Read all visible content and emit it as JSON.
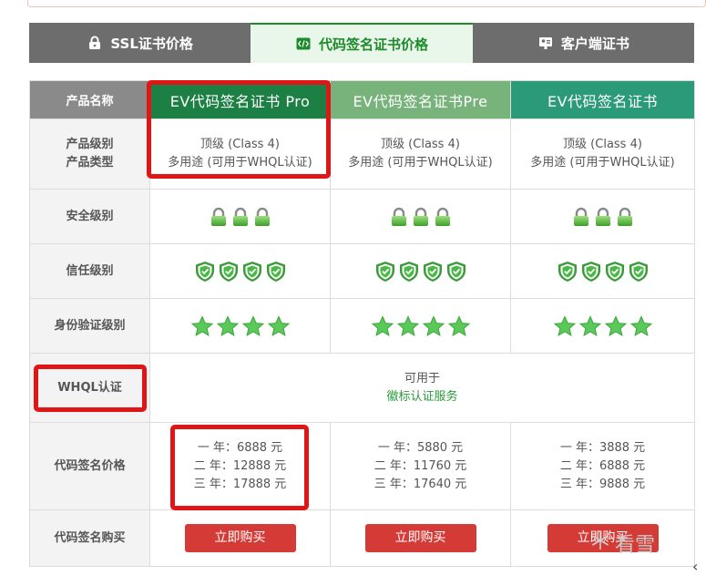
{
  "tabs": [
    {
      "label": "SSL证书价格",
      "icon": "lock-icon"
    },
    {
      "label": "代码签名证书价格",
      "icon": "code-icon"
    },
    {
      "label": "客户端证书",
      "icon": "id-card-icon"
    }
  ],
  "table": {
    "header_label": "产品名称",
    "products": [
      "EV代码签名证书 Pro",
      "EV代码签名证书Pre",
      "EV代码签名证书"
    ],
    "rows": {
      "class_label_1": "产品级别",
      "class_label_2": "产品类型",
      "class_values": [
        {
          "level": "顶级 (Class 4)",
          "type": "多用途 (可用于WHQL认证)"
        },
        {
          "level": "顶级 (Class 4)",
          "type": "多用途 (可用于WHQL认证)"
        },
        {
          "level": "顶级 (Class 4)",
          "type": "多用途 (可用于WHQL认证)"
        }
      ],
      "security_label": "安全级别",
      "security_level": 3,
      "trust_label": "信任级别",
      "trust_level": 4,
      "identity_label": "身份验证级别",
      "identity_level": 4,
      "whql_label": "WHQL认证",
      "whql_line1": "可用于",
      "whql_line2": "徽标认证服务",
      "price_label": "代码签名价格",
      "prices": [
        [
          "一 年：6888 元",
          "二 年：12888 元",
          "三 年：17888 元"
        ],
        [
          "一 年：5880 元",
          "二 年：11760 元",
          "三 年：17640 元"
        ],
        [
          "一 年：3888 元",
          "二 年：6888 元",
          "三 年：9888 元"
        ]
      ],
      "buy_label": "代码签名购买",
      "buy_button": "立即购买"
    }
  },
  "watermark": "看雪",
  "colors": {
    "tab_inactive": "#6d6d6d",
    "tab_active_bg": "#e9f7ea",
    "accent_green": "#1d8a2b",
    "product1": "#1c8044",
    "product2": "#78b37c",
    "product3": "#2a9a78",
    "buy": "#d53b36",
    "highlight": "#e01515"
  }
}
